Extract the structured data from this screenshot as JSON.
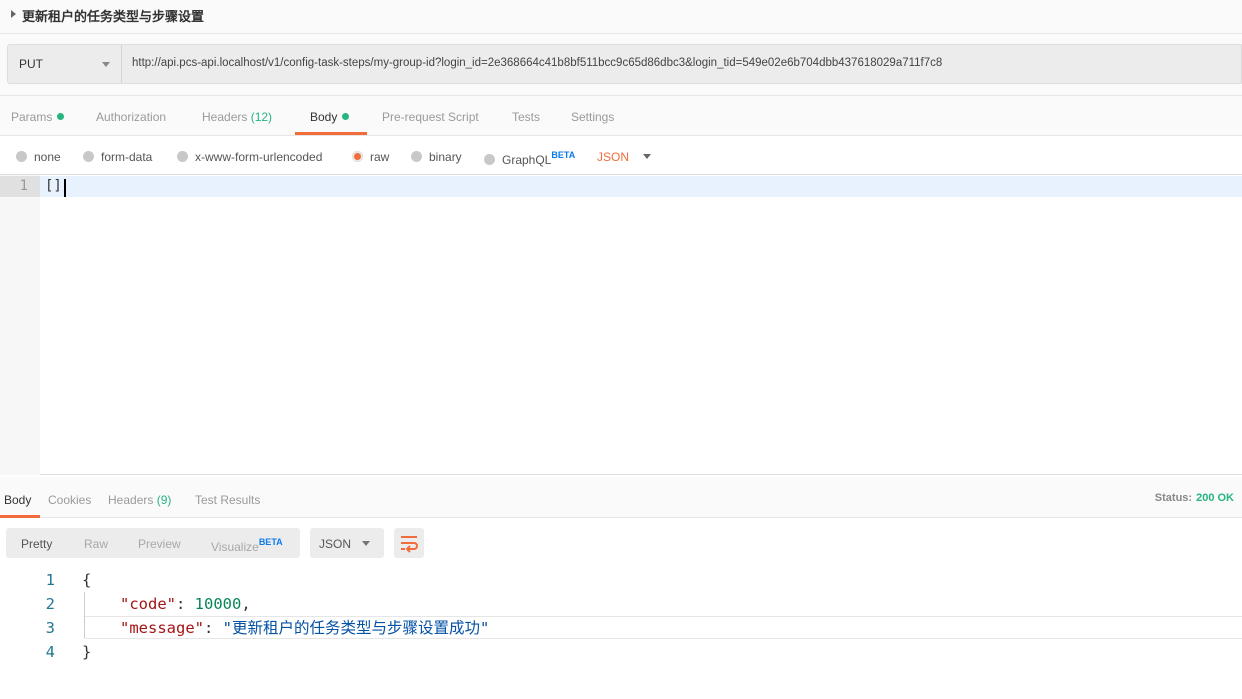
{
  "request": {
    "title": "更新租户的任务类型与步骤设置",
    "method": "PUT",
    "url": "http://api.pcs-api.localhost/v1/config-task-steps/my-group-id?login_id=2e368664c41b8bf511bcc9c65d86dbc3&login_tid=549e02e6b704dbb437618029a711f7c8"
  },
  "tabs": {
    "params": "Params",
    "authorization": "Authorization",
    "headers": "Headers",
    "headers_count": "(12)",
    "body": "Body",
    "prerequest": "Pre-request Script",
    "tests": "Tests",
    "settings": "Settings"
  },
  "body_types": {
    "none": "none",
    "form_data": "form-data",
    "urlencoded": "x-www-form-urlencoded",
    "raw": "raw",
    "binary": "binary",
    "graphql": "GraphQL",
    "beta": "BETA",
    "language": "JSON"
  },
  "editor": {
    "line": "1",
    "content": "[]"
  },
  "response": {
    "tabs": {
      "body": "Body",
      "cookies": "Cookies",
      "headers": "Headers",
      "headers_count": "(9)",
      "test_results": "Test Results"
    },
    "status_label": "Status:",
    "status": "200 OK",
    "views": {
      "pretty": "Pretty",
      "raw": "Raw",
      "preview": "Preview",
      "visualize": "Visualize",
      "beta": "BETA",
      "format": "JSON"
    },
    "lines": [
      {
        "n": "1",
        "open": "{"
      },
      {
        "n": "2",
        "key": "\"code\"",
        "sep": ": ",
        "value": "10000",
        "end": ","
      },
      {
        "n": "3",
        "key": "\"message\"",
        "sep": ": ",
        "value": "\"更新租户的任务类型与步骤设置成功\""
      },
      {
        "n": "4",
        "close": "}"
      }
    ]
  },
  "colors": {
    "accent": "#f26b3a",
    "green": "#26b47f"
  }
}
